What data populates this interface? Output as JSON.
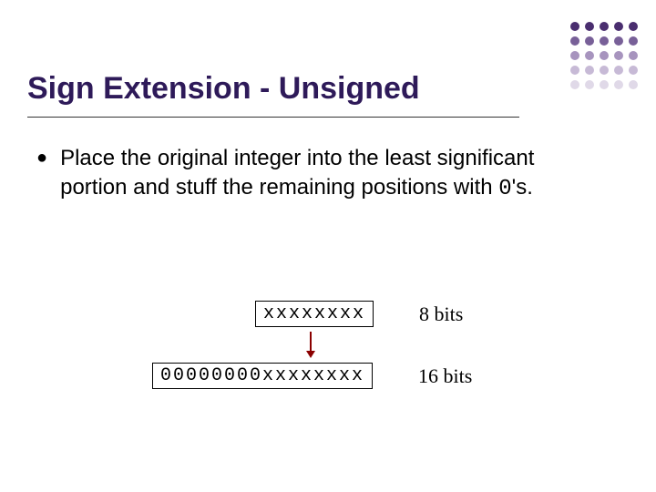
{
  "title": "Sign Extension - Unsigned",
  "bullet": {
    "symbol": "●",
    "text_a": "Place the original integer into the least significant portion and stuff the remaining positions with ",
    "zero": "0",
    "text_b": "'s."
  },
  "row8": {
    "value": "xxxxxxxx",
    "label": "8 bits"
  },
  "row16": {
    "value": "00000000xxxxxxxx",
    "label": "16 bits"
  }
}
